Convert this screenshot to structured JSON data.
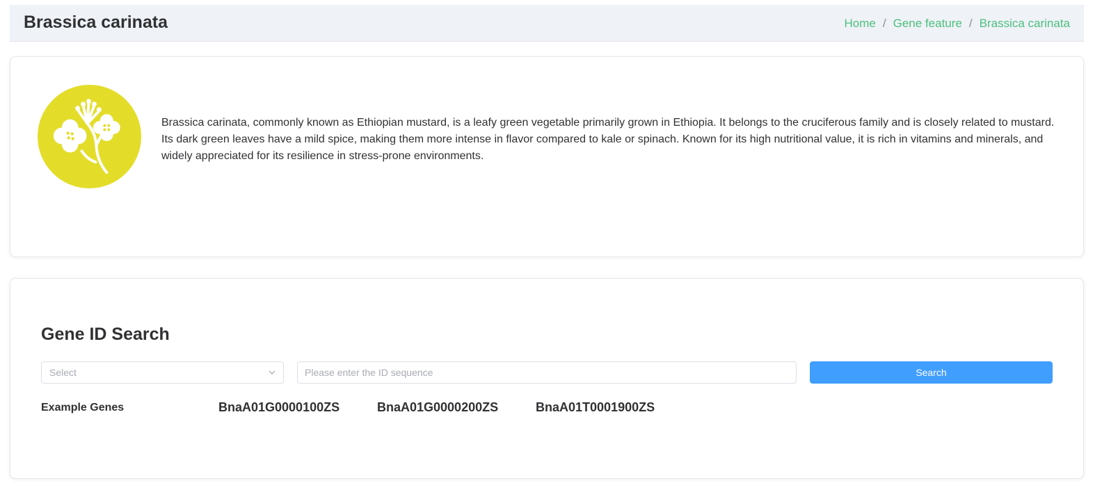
{
  "header": {
    "title": "Brassica carinata",
    "breadcrumbs": [
      {
        "label": "Home"
      },
      {
        "label": "Gene feature"
      },
      {
        "label": "Brassica carinata"
      }
    ],
    "separator": "/"
  },
  "species": {
    "logo_icon": "flower-icon",
    "logo_color": "#e3dd2a",
    "description": "Brassica carinata, commonly known as Ethiopian mustard, is a leafy green vegetable primarily grown in Ethiopia. It belongs to the cruciferous family and is closely related to mustard. Its dark green leaves have a mild spice, making them more intense in flavor compared to kale or spinach. Known for its high nutritional value, it is rich in vitamins and minerals, and widely appreciated for its resilience in stress-prone environments."
  },
  "search": {
    "title": "Gene ID Search",
    "select_placeholder": "Select",
    "input_placeholder": "Please enter the ID sequence",
    "input_value": "",
    "button_label": "Search",
    "button_color": "#409eff",
    "example_label": "Example Genes",
    "examples": [
      "BnaA01G0000100ZS",
      "BnaA01G0000200ZS",
      "BnaA01T0001900ZS"
    ]
  },
  "colors": {
    "breadcrumb_link": "#4cbf7e",
    "header_bg": "#eff2f7"
  }
}
